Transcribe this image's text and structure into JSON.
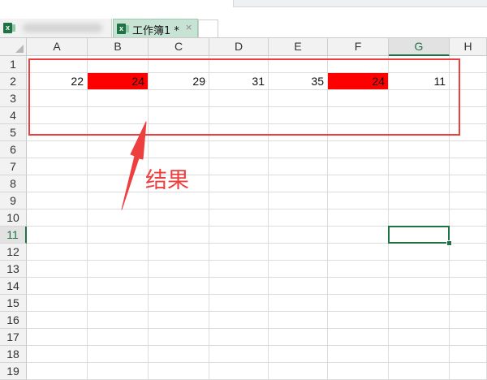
{
  "tabs": [
    {
      "label": "",
      "blurred": true,
      "active": false,
      "icon": "excel-icon"
    },
    {
      "label": "工作簿1 *",
      "active": true,
      "icon": "excel-icon",
      "close_icon": "×"
    }
  ],
  "columns": [
    "A",
    "B",
    "C",
    "D",
    "E",
    "F",
    "G",
    "H"
  ],
  "rows": [
    "1",
    "2",
    "3",
    "4",
    "5",
    "6",
    "7",
    "8",
    "9",
    "10",
    "11",
    "12",
    "13",
    "14",
    "15",
    "16",
    "17",
    "18",
    "19"
  ],
  "cells": [
    {
      "ref": "A2",
      "value": "22",
      "fill": ""
    },
    {
      "ref": "B2",
      "value": "24",
      "fill": "#ff0000"
    },
    {
      "ref": "C2",
      "value": "29",
      "fill": ""
    },
    {
      "ref": "D2",
      "value": "31",
      "fill": ""
    },
    {
      "ref": "E2",
      "value": "35",
      "fill": ""
    },
    {
      "ref": "F2",
      "value": "24",
      "fill": "#ff0000"
    },
    {
      "ref": "G2",
      "value": "11",
      "fill": ""
    }
  ],
  "selection": {
    "active_cell": "G11"
  },
  "annotation": {
    "label": "结果",
    "color": "#ee3f3f",
    "icon": "red-arrow-up-icon"
  },
  "colors": {
    "accent": "#1f7244",
    "highlight": "#ff0000",
    "annotation": "#ee3f3f"
  }
}
